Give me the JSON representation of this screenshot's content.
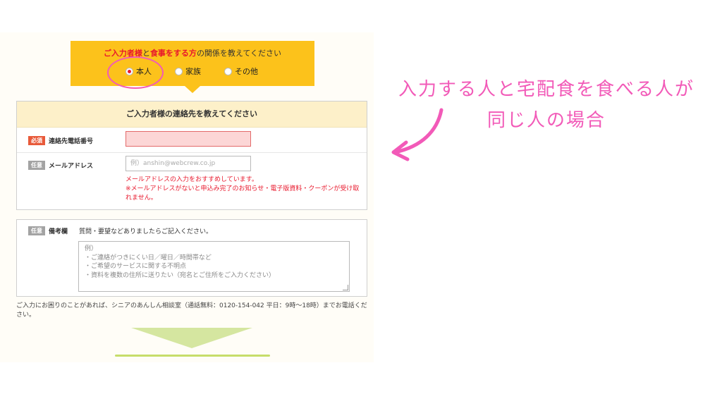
{
  "relationship": {
    "question_parts": [
      "ご入力者様",
      "と",
      "食事をする方",
      "の関係を教えてください"
    ],
    "options": [
      {
        "label": "本人",
        "selected": true
      },
      {
        "label": "家族",
        "selected": false
      },
      {
        "label": "その他",
        "selected": false
      }
    ]
  },
  "contact": {
    "title": "ご入力者様の連絡先を教えてください",
    "phone": {
      "badge": "必須",
      "label": "連絡先電話番号",
      "value": ""
    },
    "email": {
      "badge": "任意",
      "label": "メールアドレス",
      "placeholder": "例）anshin@webcrew.co.jp",
      "note1": "メールアドレスの入力をおすすめしています。",
      "note2": "※メールアドレスがないと申込み完了のお知らせ・電子版資料・クーポンが受け取れません。"
    }
  },
  "remarks": {
    "badge": "任意",
    "label": "備考欄",
    "hint": "質問・要望などありましたらご記入ください。",
    "placeholder_lines": [
      "例）",
      "・ご連絡がつきにくい日／曜日／時間帯など",
      "・ご希望のサービスに関する不明点",
      "・資料を複数の住所に送りたい（宛名とご住所をご入力ください）"
    ]
  },
  "help_text": "ご入力にお困りのことがあれば、シニアのあんしん相談室（通話無料：0120-154-042 平日：9時〜18時）までお電話ください。",
  "annotation": {
    "line1": "入力する人と宅配食を食べる人が",
    "line2": "同じ人の場合"
  },
  "colors": {
    "accent_yellow": "#fcc21b",
    "highlight_red": "#e8182c",
    "annotation_pink": "#f25ab8",
    "panel_header": "#fdf0c9",
    "next_green": "#d5e6a0"
  }
}
